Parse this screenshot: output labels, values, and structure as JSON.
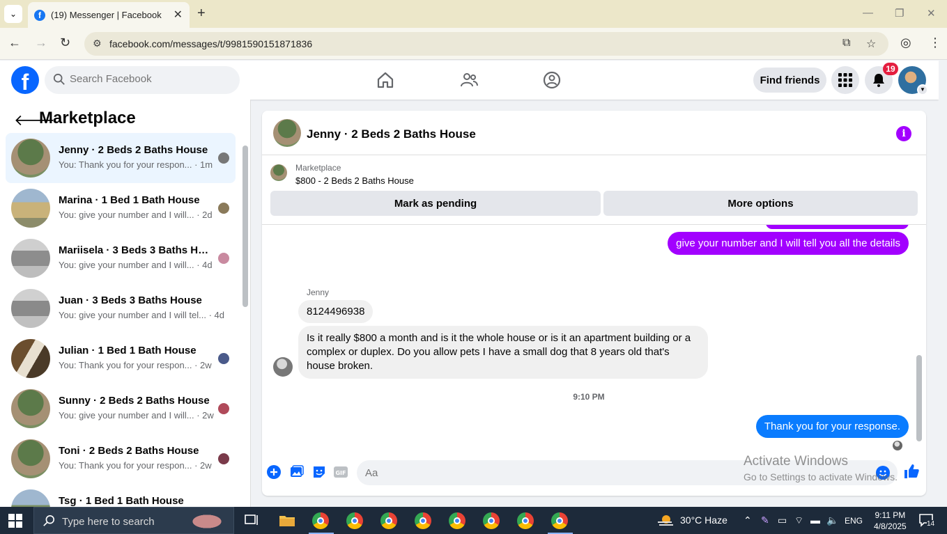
{
  "browser": {
    "tab_title": "(19) Messenger | Facebook",
    "url": "facebook.com/messages/t/9981590151871836"
  },
  "header": {
    "search_placeholder": "Search Facebook",
    "find_friends": "Find friends",
    "notification_count": "19",
    "brand_color": "#0866ff"
  },
  "sidebar": {
    "title": "Marketplace",
    "conversations": [
      {
        "name": "Jenny · 2 Beds 2 Baths House",
        "preview": "You: Thank you for your respon... · 1m",
        "active": true
      },
      {
        "name": "Marina · 1 Bed 1 Bath House",
        "preview": "You: give your number and I will... · 2d"
      },
      {
        "name": "Mariisela · 3 Beds 3 Baths Ho...",
        "preview": "You: give your number and I will... · 4d"
      },
      {
        "name": "Juan · 3 Beds 3 Baths House",
        "preview": "You: give your number and I will tel... · 4d"
      },
      {
        "name": "Julian · 1 Bed 1 Bath House",
        "preview": "You: Thank you for your respon... · 2w"
      },
      {
        "name": "Sunny · 2 Beds 2 Baths House",
        "preview": "You: give your number and I will... · 2w"
      },
      {
        "name": "Toni · 2 Beds 2 Baths House",
        "preview": "You: Thank you for your respon... · 2w"
      },
      {
        "name": "Tsg · 1 Bed 1 Bath House",
        "preview": ""
      }
    ]
  },
  "chat": {
    "title": "Jenny · 2 Beds 2 Baths House",
    "listing_label": "Marketplace",
    "listing_price": "$800 - 2 Beds 2 Baths House",
    "mark_pending": "Mark as pending",
    "more_options": "More options",
    "sender": "Jenny",
    "messages": {
      "out_1": "give your number and I will tell you all the details",
      "in_1": "8124496938",
      "in_2": "Is it really $800 a month and is it the whole house or is it an apartment building or a complex or duplex. Do you allow pets I have a small dog that 8 years old that's house broken.",
      "time": "9:10 PM",
      "out_2": "Thank you for your response."
    },
    "composer_placeholder": "Aa",
    "accent_purple": "#a200ff",
    "accent_blue": "#0a7cff"
  },
  "watermark": {
    "line1": "Activate Windows",
    "line2": "Go to Settings to activate Windows."
  },
  "taskbar": {
    "search_placeholder": "Type here to search",
    "weather": "30°C  Haze",
    "lang": "ENG",
    "time": "9:11 PM",
    "date": "4/8/2025",
    "notif_count": "14"
  }
}
